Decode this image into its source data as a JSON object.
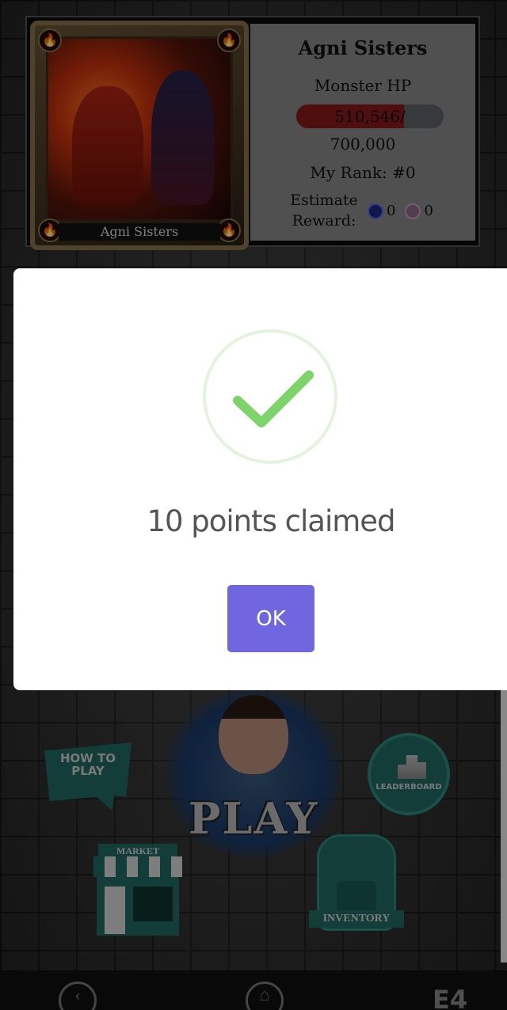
{
  "boss": {
    "card_name": "Agni Sisters",
    "title": "Agni Sisters",
    "hp_label": "Monster HP",
    "hp_current": "510,546",
    "hp_separator": "/",
    "hp_max": "700,000",
    "hp_fraction": 0.729,
    "rank_label": "My Rank: #0",
    "reward_label_line1": "Estimate",
    "reward_label_line2": "Reward:",
    "reward_steem": "0",
    "reward_token": "0"
  },
  "menu": {
    "how_to_play_line1": "HOW TO",
    "how_to_play_line2": "PLAY",
    "play_label": "PLAY",
    "leaderboard_label": "LEADERBOARD",
    "market_label": "MARKET",
    "inventory_label": "INVENTORY"
  },
  "modal": {
    "message": "10 points claimed",
    "ok_label": "OK",
    "icon": "success-check-icon",
    "check_color": "#7cd46a",
    "ring_color": "#e4f4dc",
    "button_color": "#7066e0"
  },
  "nav": {
    "back_icon": "chevron-left-icon",
    "home_icon": "home-icon",
    "logo_text": "E4"
  }
}
